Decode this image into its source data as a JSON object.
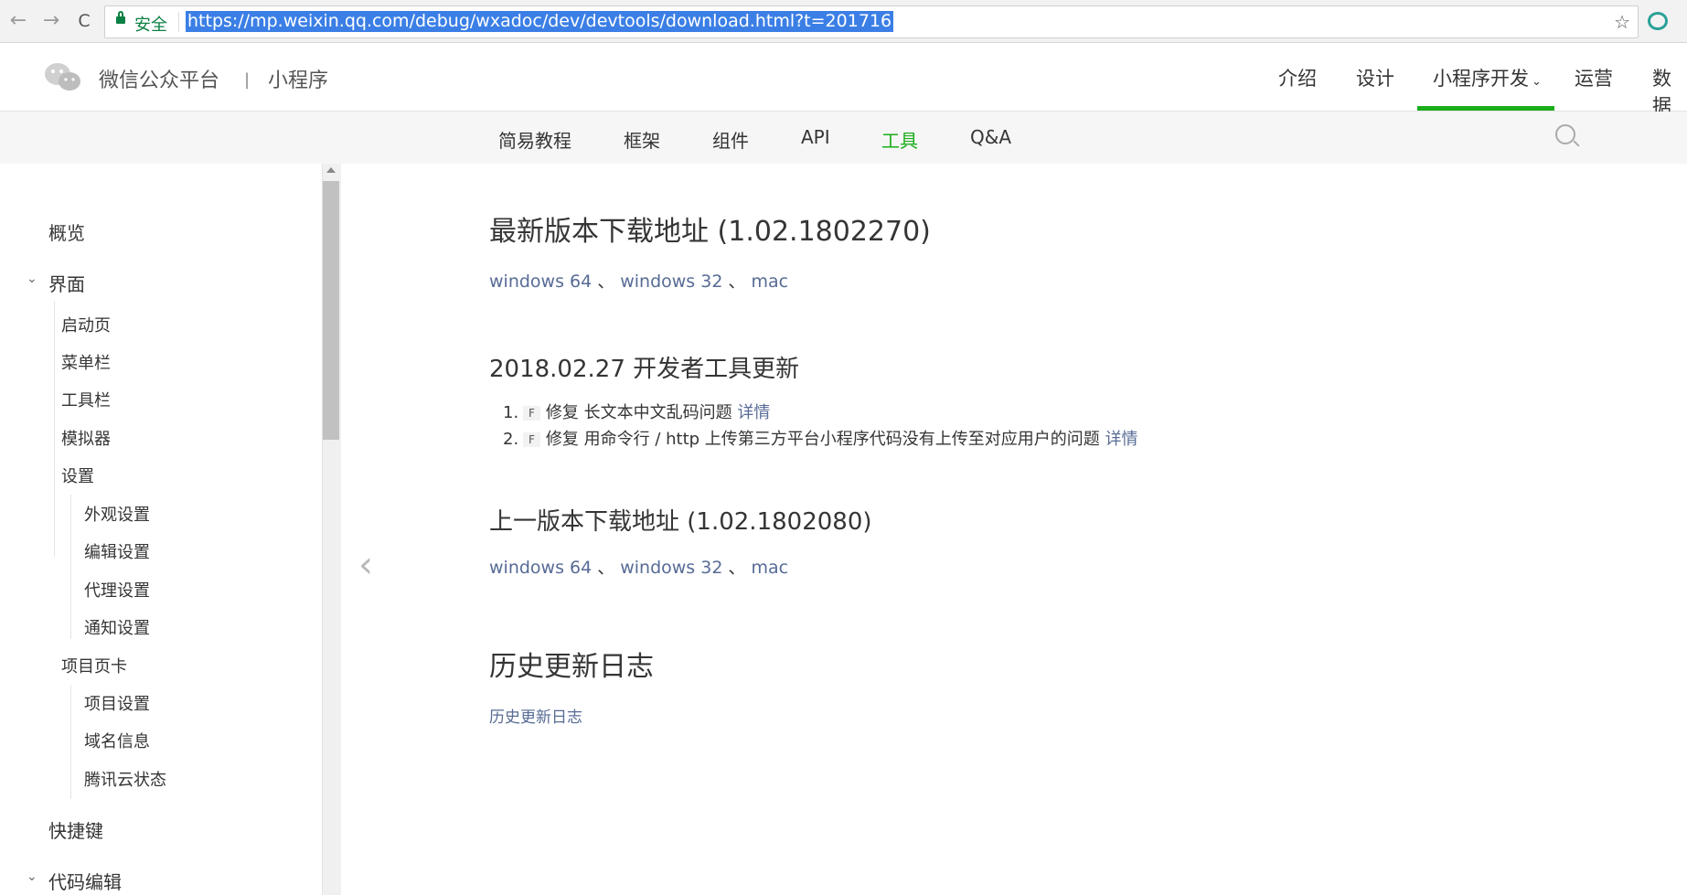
{
  "browser": {
    "back": "←",
    "forward": "→",
    "reload": "C",
    "secure_label": "安全",
    "url": "https://mp.weixin.qq.com/debug/wxadoc/dev/devtools/download.html?t=201716",
    "star": "☆"
  },
  "header": {
    "brand": "微信公众平台",
    "divider": "|",
    "sub": "小程序",
    "nav": [
      "介绍",
      "设计",
      "小程序开发",
      "运营",
      "数据"
    ],
    "active_nav": "小程序开发",
    "accent": "#1aad19"
  },
  "subnav": {
    "items": [
      "简易教程",
      "框架",
      "组件",
      "API",
      "工具",
      "Q&A"
    ],
    "active": "工具"
  },
  "sidebar": {
    "items": [
      {
        "label": "概览",
        "level": 1
      },
      {
        "label": "界面",
        "level": 1,
        "expanded": true
      },
      {
        "label": "启动页",
        "level": 2
      },
      {
        "label": "菜单栏",
        "level": 2
      },
      {
        "label": "工具栏",
        "level": 2
      },
      {
        "label": "模拟器",
        "level": 2
      },
      {
        "label": "设置",
        "level": 2
      },
      {
        "label": "外观设置",
        "level": 3
      },
      {
        "label": "编辑设置",
        "level": 3
      },
      {
        "label": "代理设置",
        "level": 3
      },
      {
        "label": "通知设置",
        "level": 3
      },
      {
        "label": "项目页卡",
        "level": 2
      },
      {
        "label": "项目设置",
        "level": 3
      },
      {
        "label": "域名信息",
        "level": 3
      },
      {
        "label": "腾讯云状态",
        "level": 3
      },
      {
        "label": "快捷键",
        "level": 1
      },
      {
        "label": "代码编辑",
        "level": 1,
        "expanded": true
      }
    ]
  },
  "content": {
    "latest_title": "最新版本下载地址 (1.02.1802270)",
    "latest_links": [
      "windows 64",
      "windows 32",
      "mac"
    ],
    "separator": "、",
    "update_title": "2018.02.27 开发者工具更新",
    "updates": [
      {
        "num": "1.",
        "tag": "F",
        "text": "修复 长文本中文乱码问题",
        "link": "详情"
      },
      {
        "num": "2.",
        "tag": "F",
        "text": "修复 用命令行 / http 上传第三方平台小程序代码没有上传至对应用户的问题",
        "link": "详情"
      }
    ],
    "prev_title": "上一版本下载地址 (1.02.1802080)",
    "prev_links": [
      "windows 64",
      "windows 32",
      "mac"
    ],
    "history_title": "历史更新日志",
    "history_link": "历史更新日志"
  }
}
